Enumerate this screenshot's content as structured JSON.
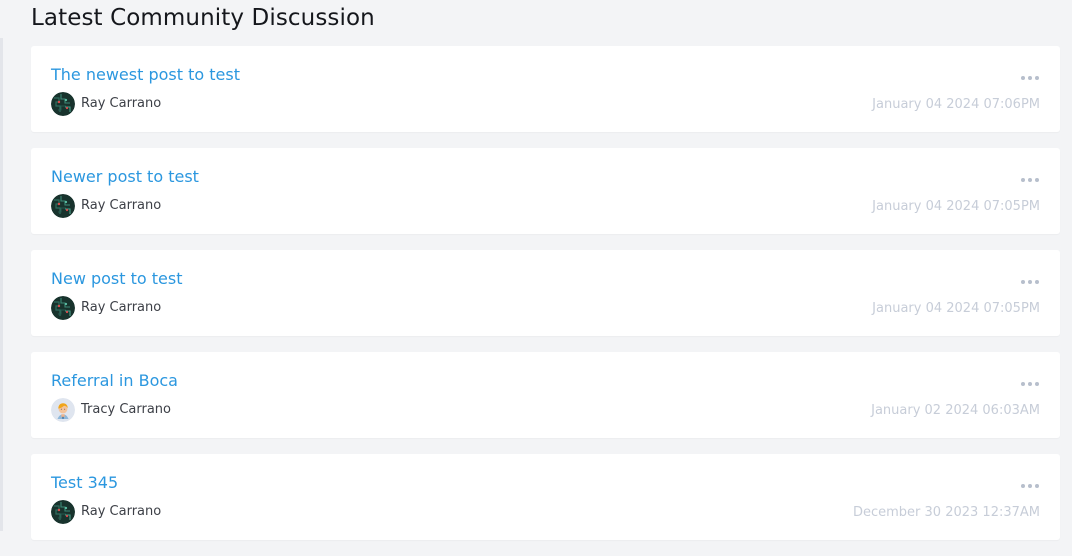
{
  "page": {
    "section_title": "Latest Community Discussion"
  },
  "posts": [
    {
      "title": "The newest post to test",
      "author": "Ray Carrano",
      "timestamp": "January 04 2024 07:06PM",
      "avatar": "dark-circuit-avatar"
    },
    {
      "title": "Newer post to test",
      "author": "Ray Carrano",
      "timestamp": "January 04 2024 07:05PM",
      "avatar": "dark-circuit-avatar"
    },
    {
      "title": "New post to test",
      "author": "Ray Carrano",
      "timestamp": "January 04 2024 07:05PM",
      "avatar": "dark-circuit-avatar"
    },
    {
      "title": "Referral in Boca",
      "author": "Tracy Carrano",
      "timestamp": "January 02 2024 06:03AM",
      "avatar": "cartoon-person-avatar"
    },
    {
      "title": "Test 345",
      "author": "Ray Carrano",
      "timestamp": "December 30 2023 12:37AM",
      "avatar": "dark-circuit-avatar"
    }
  ],
  "colors": {
    "page_background": "#f3f4f6",
    "card_background": "#ffffff",
    "title_link": "#2b97df",
    "author_text": "#3d4047",
    "timestamp_text": "#c7cdd8",
    "more_icon": "#b7bfcc"
  },
  "icons": {
    "more": "more-options-icon"
  }
}
